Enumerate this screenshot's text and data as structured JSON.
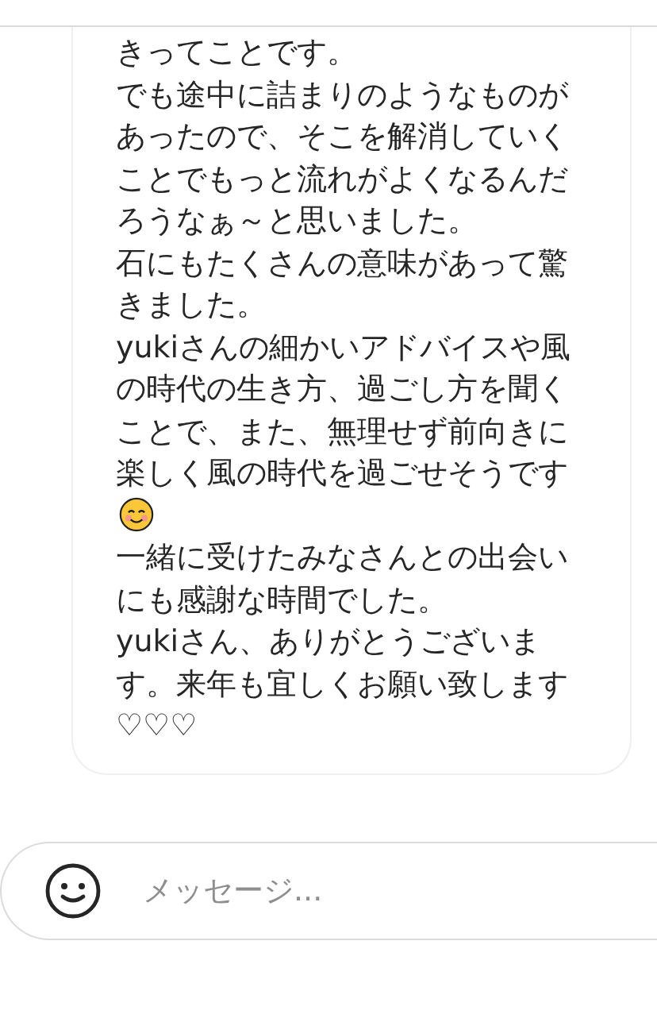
{
  "message": {
    "paragraphs": [
      {
        "text": "きってことです。"
      },
      {
        "text": "でも途中に詰まりのようなものがあったので、そこを解消していくことでもっと流れがよくなるんだろうなぁ～と思いました。"
      },
      {
        "text": "石にもたくさんの意味があって驚きました。"
      },
      {
        "text": "yukiさんの細かいアドバイスや風の時代の生き方、過ごし方を聞くことで、また、無理せず前向きに楽しく風の時代を過ごせそうです",
        "emoji": true
      },
      {
        "text": "一緒に受けたみなさんとの出会いにも感謝な時間でした。"
      },
      {
        "text": "yukiさん、ありがとうございます。来年も宜しくお願い致します♡♡♡"
      }
    ]
  },
  "composer": {
    "placeholder": "メッセージ..."
  }
}
